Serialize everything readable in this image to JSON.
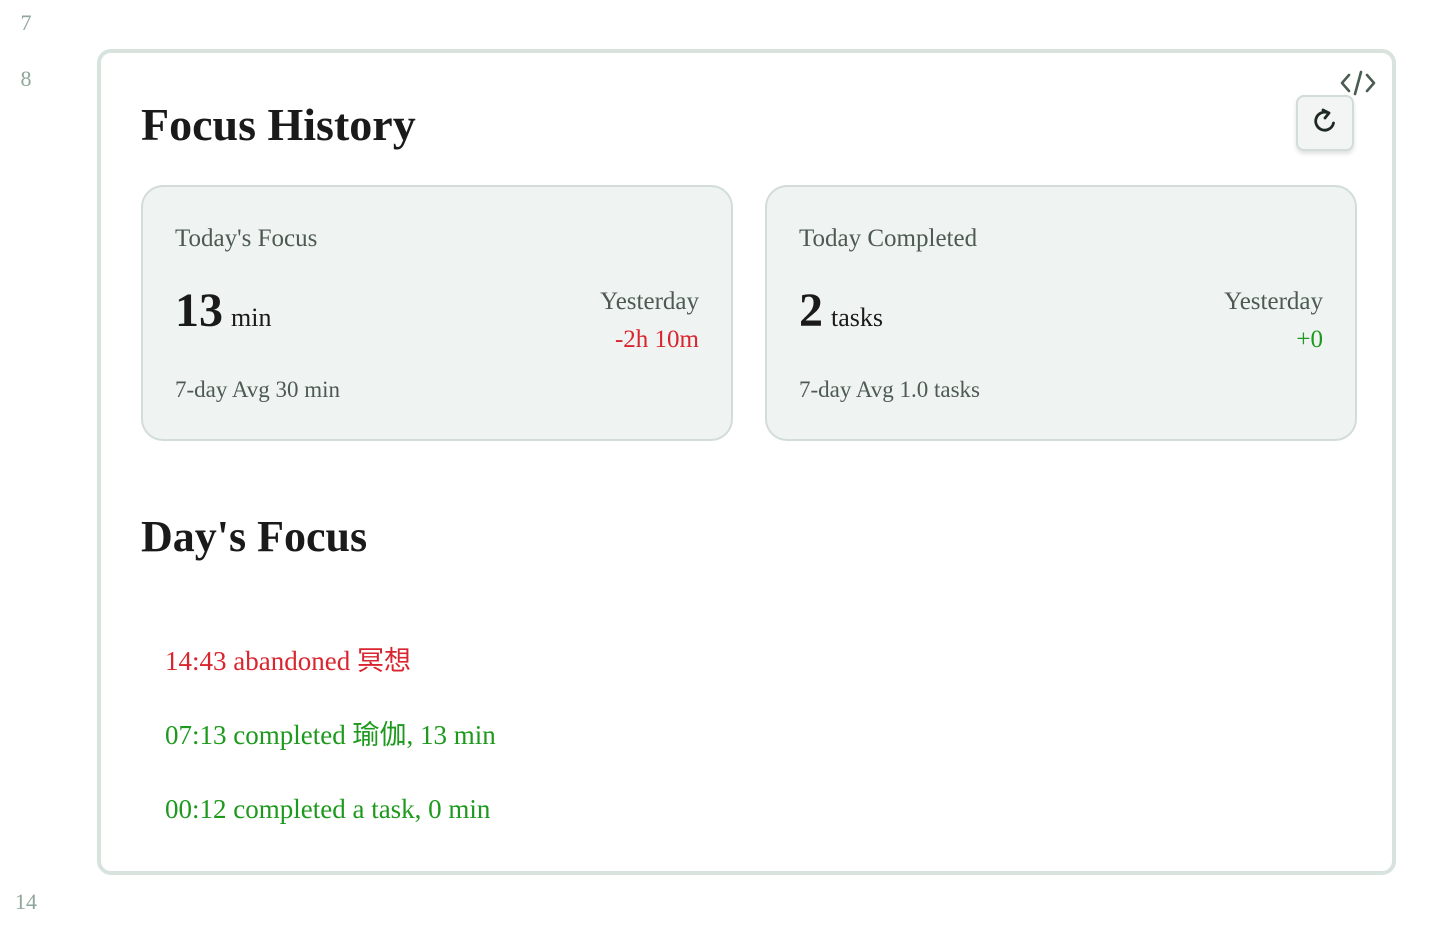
{
  "line_numbers": [
    "7",
    "8",
    "14"
  ],
  "colors": {
    "abandoned": "#d9252f",
    "completed": "#1d9a1d",
    "card_background": "#eff3f1",
    "panel_border": "#d9e3de"
  },
  "toolbar": {
    "code_icon": "code-icon",
    "refresh_icon": "refresh-icon"
  },
  "header": {
    "title": "Focus History"
  },
  "cards": [
    {
      "label": "Today's Focus",
      "value": "13",
      "unit": "min",
      "yesterday_label": "Yesterday",
      "yesterday_delta": "-2h 10m",
      "average": "7-day Avg 30 min"
    },
    {
      "label": "Today Completed",
      "value": "2",
      "unit": "tasks",
      "yesterday_label": "Yesterday",
      "yesterday_delta": "+0",
      "average": "7-day Avg 1.0 tasks"
    }
  ],
  "day_focus": {
    "title": "Day's Focus",
    "entries": [
      {
        "text": "14:43 abandoned 冥想",
        "status": "abandoned"
      },
      {
        "text": "07:13 completed 瑜伽, 13 min",
        "status": "completed"
      },
      {
        "text": "00:12 completed a task, 0 min",
        "status": "completed"
      }
    ]
  }
}
